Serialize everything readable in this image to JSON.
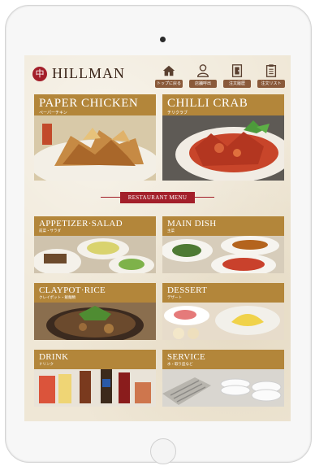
{
  "brand": {
    "name": "HILLMAN",
    "mark": "中"
  },
  "toolbar": [
    {
      "icon": "home-icon",
      "label": "トップに戻る"
    },
    {
      "icon": "person-icon",
      "label": "店舗呼出"
    },
    {
      "icon": "door-icon",
      "label": "注文履歴"
    },
    {
      "icon": "clipboard-icon",
      "label": "注文リスト"
    }
  ],
  "featured": [
    {
      "title": "PAPER CHICKEN",
      "subtitle": "ペーパーチキン"
    },
    {
      "title": "CHILLI CRAB",
      "subtitle": "チリクラブ"
    }
  ],
  "menu_ribbon": "RESTAURANT MENU",
  "categories": [
    {
      "title": "APPETIZER·SALAD",
      "subtitle": "前菜・サラダ"
    },
    {
      "title": "MAIN DISH",
      "subtitle": "主菜"
    },
    {
      "title": "CLAYPOT·RICE",
      "subtitle": "クレイポット・飯麺類"
    },
    {
      "title": "DESSERT",
      "subtitle": "デザート"
    },
    {
      "title": "DRINK",
      "subtitle": "ドリンク"
    },
    {
      "title": "SERVICE",
      "subtitle": "水・取り皿など"
    }
  ],
  "colors": {
    "band": "#b3863a",
    "accent": "#a31f2a",
    "background": "#efe7d6"
  }
}
